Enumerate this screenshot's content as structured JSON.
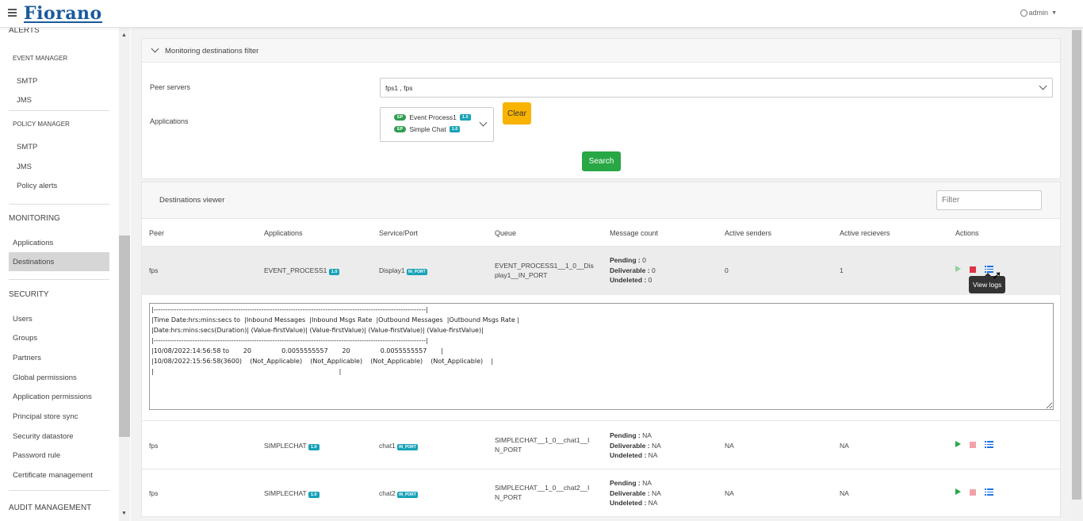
{
  "header": {
    "logo": "Fiorano",
    "user": "admin"
  },
  "sidebar": {
    "alerts_label": "ALERTS",
    "event_manager": {
      "label": "EVENT MANAGER",
      "items": [
        "SMTP",
        "JMS"
      ]
    },
    "policy_manager": {
      "label": "POLICY MANAGER",
      "items": [
        "SMTP",
        "JMS",
        "Policy alerts"
      ]
    },
    "monitoring": {
      "label": "MONITORING",
      "items": [
        "Applications",
        "Destinations"
      ]
    },
    "security": {
      "label": "SECURITY",
      "items": [
        "Users",
        "Groups",
        "Partners",
        "Global permissions",
        "Application permissions",
        "Principal store sync",
        "Security datastore",
        "Password rule",
        "Certificate management"
      ]
    },
    "audit_label": "AUDIT MANAGEMENT"
  },
  "filter": {
    "title": "Monitoring destinations filter",
    "peer_label": "Peer servers",
    "peer_value": "fps1 , fps",
    "apps_label": "Applications",
    "apps": [
      {
        "tag": "EP",
        "name": "Event Process1",
        "version": "1.0"
      },
      {
        "tag": "EP",
        "name": "Simple Chat",
        "version": "1.0"
      }
    ],
    "clear_label": "Clear",
    "search_label": "Search"
  },
  "viewer": {
    "title": "Destinations viewer",
    "filter_placeholder": "Filter",
    "columns": [
      "Peer",
      "Applications",
      "Service/Port",
      "Queue",
      "Message count",
      "Active senders",
      "Active recievers",
      "Actions"
    ],
    "count_labels": {
      "pending": "Pending :",
      "deliverable": "Deliverable :",
      "undeleted": "Undeleted :"
    },
    "rows": [
      {
        "peer": "fps",
        "app": "EVENT_PROCESS1",
        "version": "1.0",
        "service": "Display1",
        "port_type": "IN_PORT",
        "queue": "EVENT_PROCESS1__1_0__Display1__IN_PORT",
        "pending": "0",
        "deliverable": "0",
        "undeleted": "0",
        "senders": "0",
        "receivers": "1"
      },
      {
        "peer": "fps",
        "app": "SIMPLECHAT",
        "version": "1.0",
        "service": "chat1",
        "port_type": "IN_PORT",
        "queue": "SIMPLECHAT__1_0__chat1__IN_PORT",
        "pending": "NA",
        "deliverable": "NA",
        "undeleted": "NA",
        "senders": "NA",
        "receivers": "NA"
      },
      {
        "peer": "fps",
        "app": "SIMPLECHAT",
        "version": "1.0",
        "service": "chat2",
        "port_type": "IN_PORT",
        "queue": "SIMPLECHAT__1_0__chat2__IN_PORT",
        "pending": "NA",
        "deliverable": "NA",
        "undeleted": "NA",
        "senders": "NA",
        "receivers": "NA"
      }
    ],
    "tooltip": "View logs",
    "log_text": "|-----------------------------------------------------------------------------------------------------------------------|\n|Time Date:hrs:mins:secs to  |Inbound Messages  |Inbound Msgs Rate  |Outbound Messages  |Outbound Msgs Rate |\n|Date:hrs:mins:secs(Duration)| (Value-firstValue)| (Value-firstValue)| (Value-firstValue)| (Value-firstValue)|\n|-----------------------------------------------------------------------------------------------------------------------|\n|10/08/2022:14:56:58 to       20               0.0055555557       20               0.0055555557       |\n|10/08/2022:15:56:58(3600)    (Not_Applicable)    (Not_Applicable)    (Not_Applicable)    (Not_Applicable)    |\n|                                                                                            |"
  }
}
